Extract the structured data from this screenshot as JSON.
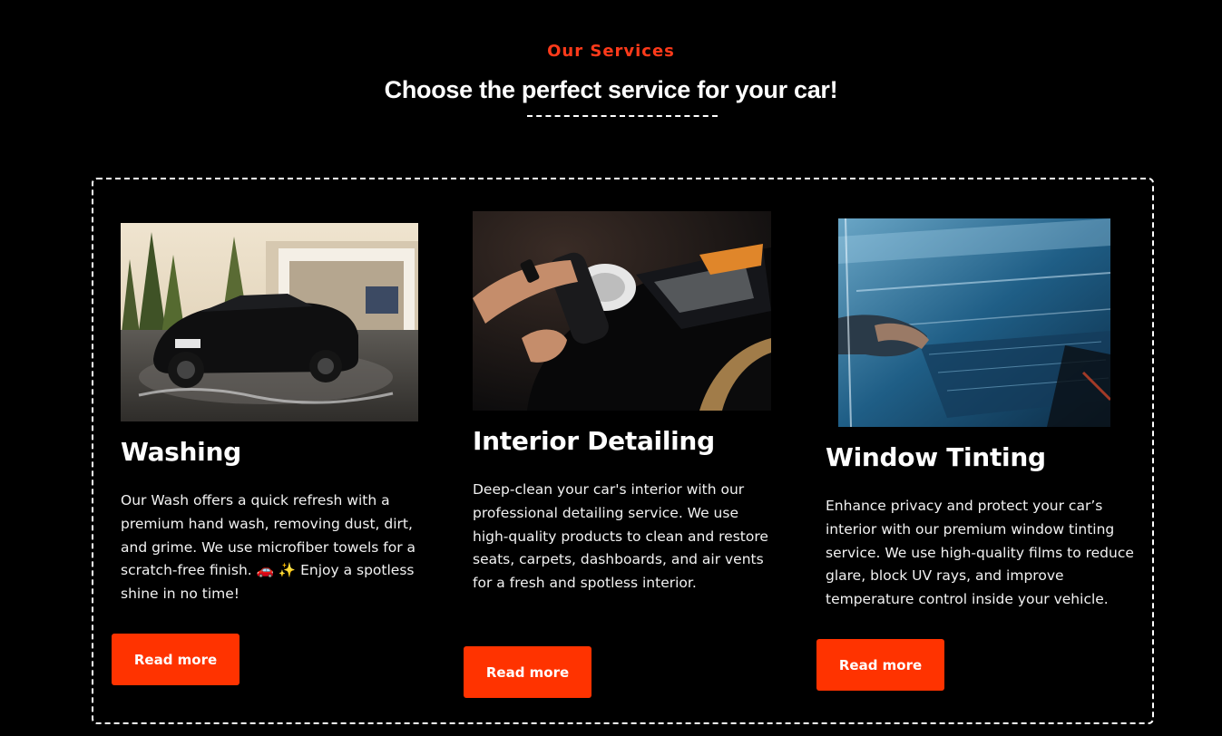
{
  "section": {
    "eyebrow": "Our Services",
    "headline": "Choose the perfect service for your car!"
  },
  "cards": [
    {
      "title": "Washing",
      "description": "Our Wash offers a quick refresh with a premium hand wash, removing dust, dirt, and grime. We use microfiber towels for a scratch-free finish. 🚗 ✨ Enjoy a spotless shine in no time!",
      "button_label": "Read more",
      "image": "black sports car being washed in a driveway"
    },
    {
      "title": "Interior Detailing",
      "description": "Deep-clean your car's interior with our professional detailing service. We use high-quality products to clean and restore seats, carpets, dashboards, and air vents for a fresh and spotless interior.",
      "button_label": "Read more",
      "image": "hands polishing a black car with a buffer"
    },
    {
      "title": "Window Tinting",
      "description": "Enhance privacy and protect your car’s interior with our premium window tinting service. We use high-quality films to reduce glare, block UV rays, and improve temperature control inside your vehicle.",
      "button_label": "Read more",
      "image": "applying tint film to a car window"
    }
  ],
  "colors": {
    "background": "#000000",
    "accent": "#ff3300",
    "eyebrow": "#ff3a1a",
    "text": "#ffffff"
  }
}
